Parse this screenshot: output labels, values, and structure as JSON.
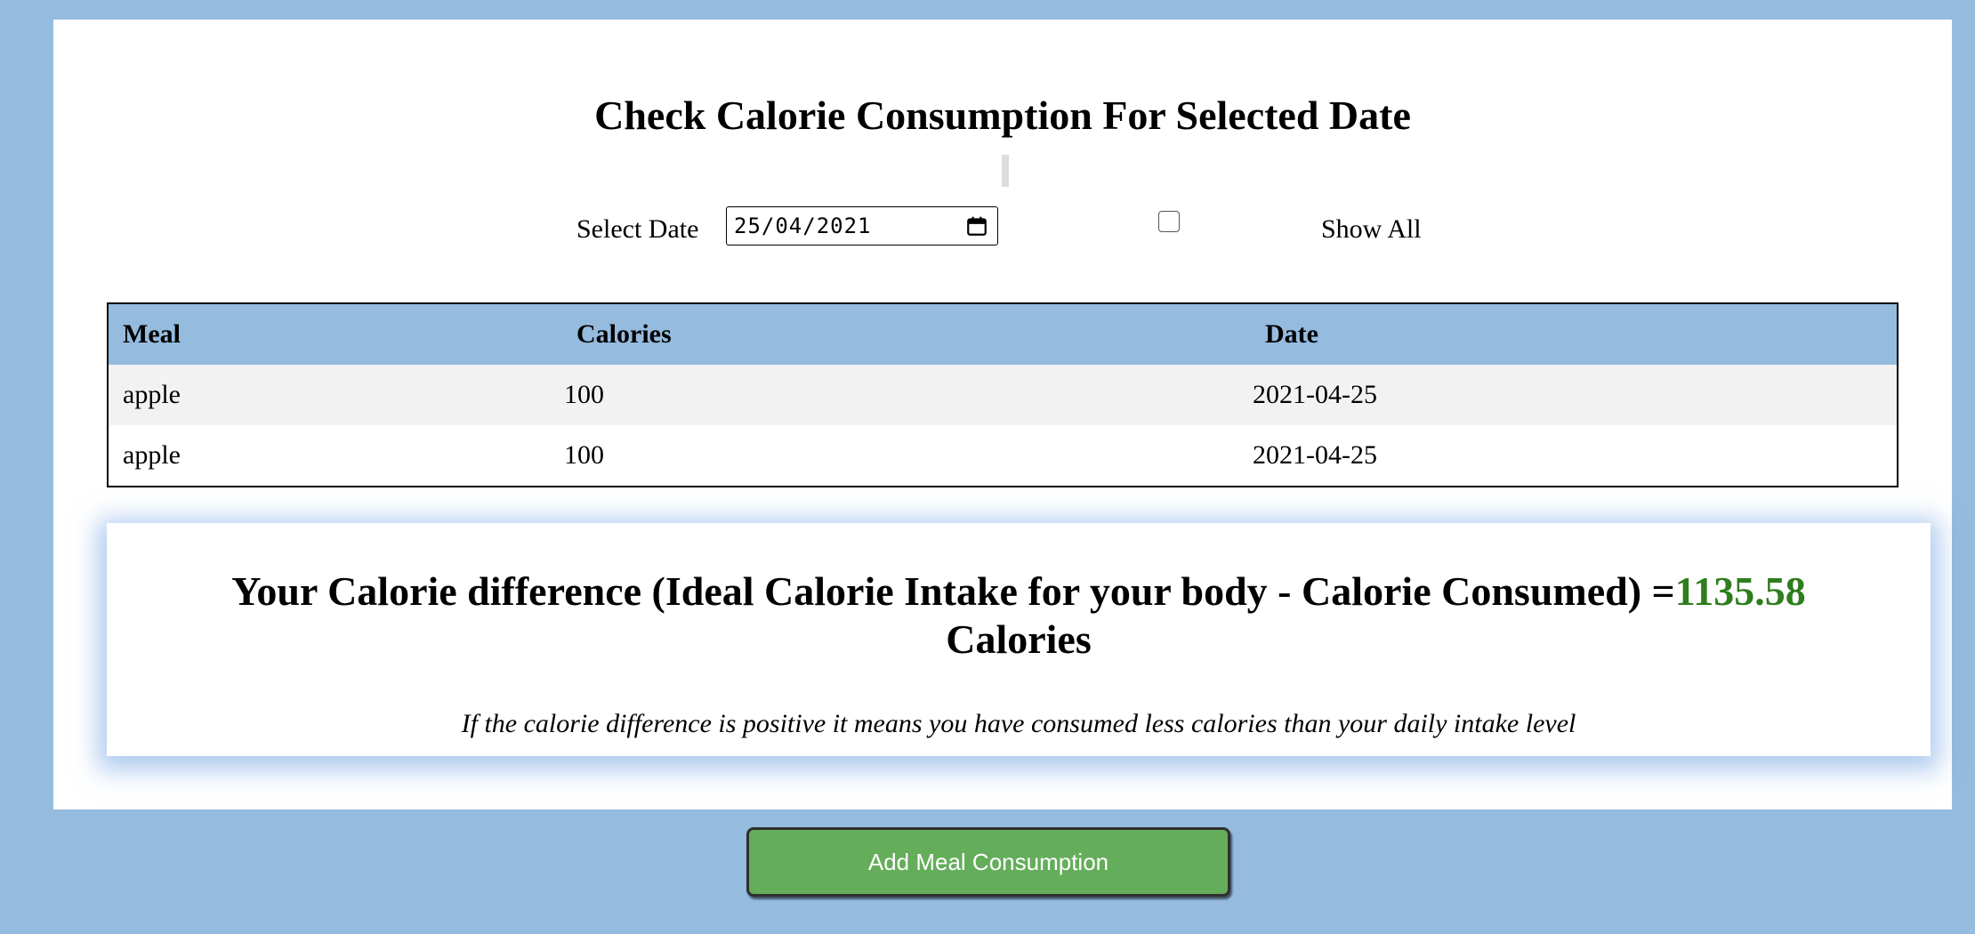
{
  "page": {
    "title": "Check Calorie Consumption For Selected Date"
  },
  "filter": {
    "select_date_label": "Select Date",
    "date_value": "25/04/2021",
    "show_all_label": "Show All",
    "show_all_checked": false
  },
  "table": {
    "headers": {
      "meal": "Meal",
      "calories": "Calories",
      "date": "Date"
    },
    "rows": [
      {
        "meal": "apple",
        "calories": "100",
        "date": "2021-04-25"
      },
      {
        "meal": "apple",
        "calories": "100",
        "date": "2021-04-25"
      }
    ]
  },
  "summary": {
    "heading_prefix": "Your Calorie difference (Ideal Calorie Intake for your body - Calorie Consumed) =",
    "value": "1135.58",
    "unit": "Calories",
    "note": "If the calorie difference is positive it means you have consumed less calories than your daily intake level"
  },
  "actions": {
    "add_meal_label": "Add Meal Consumption"
  },
  "colors": {
    "background": "#95bbdf",
    "table_header": "#95bbdf",
    "difference_value": "#2e7d1e",
    "button": "#64ad5a"
  },
  "icons": {
    "date_picker": "calendar-icon"
  }
}
